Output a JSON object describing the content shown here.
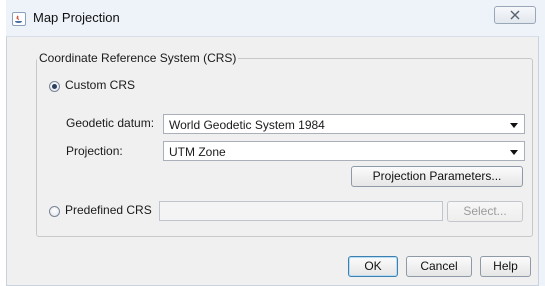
{
  "window": {
    "title": "Map Projection",
    "close_symbol": "✕"
  },
  "group": {
    "legend": "Coordinate Reference System (CRS)"
  },
  "custom_crs": {
    "label": "Custom CRS",
    "selected": true
  },
  "geodetic_datum": {
    "label": "Geodetic datum:",
    "value": "World Geodetic System 1984"
  },
  "projection": {
    "label": "Projection:",
    "value": "UTM Zone"
  },
  "projection_parameters_button": "Projection Parameters...",
  "predefined_crs": {
    "label": "Predefined CRS",
    "selected": false,
    "value": "",
    "select_button": "Select..."
  },
  "footer": {
    "ok": "OK",
    "cancel": "Cancel",
    "help": "Help"
  },
  "icons": {
    "app": "java-app-icon",
    "close": "close-icon",
    "dropdown": "chevron-down-icon"
  }
}
